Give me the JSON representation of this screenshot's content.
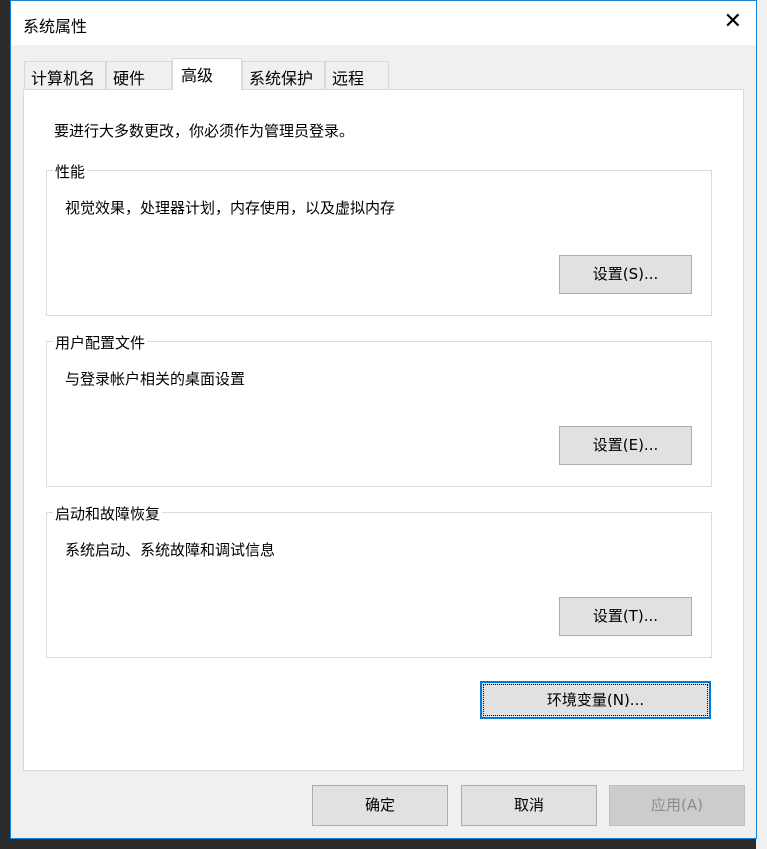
{
  "window": {
    "title": "系统属性"
  },
  "tabs": [
    {
      "label": "计算机名"
    },
    {
      "label": "硬件"
    },
    {
      "label": "高级"
    },
    {
      "label": "系统保护"
    },
    {
      "label": "远程"
    }
  ],
  "intro": "要进行大多数更改，你必须作为管理员登录。",
  "groups": [
    {
      "title": "性能",
      "desc": "视觉效果，处理器计划，内存使用，以及虚拟内存",
      "button": "设置(S)..."
    },
    {
      "title": "用户配置文件",
      "desc": "与登录帐户相关的桌面设置",
      "button": "设置(E)..."
    },
    {
      "title": "启动和故障恢复",
      "desc": "系统启动、系统故障和调试信息",
      "button": "设置(T)..."
    }
  ],
  "env_button": "环境变量(N)...",
  "footer": {
    "ok": "确定",
    "cancel": "取消",
    "apply": "应用(A)"
  }
}
